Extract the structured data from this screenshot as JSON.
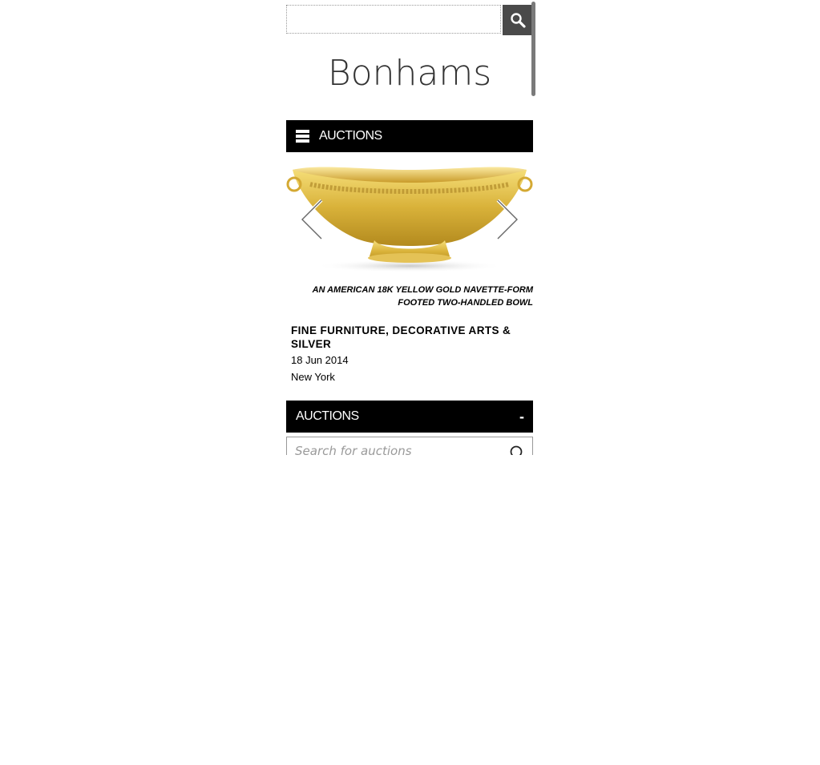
{
  "header": {
    "search_placeholder": "",
    "logo_text": "Bonhams"
  },
  "menu": {
    "label": "AUCTIONS"
  },
  "carousel": {
    "caption_line1": "AN AMERICAN 18K YELLOW GOLD NAVETTE-FORM",
    "caption_line2": "FOOTED TWO-HANDLED BOWL"
  },
  "auction": {
    "title": "FINE FURNITURE, DECORATIVE ARTS & SILVER",
    "date": "18 Jun 2014",
    "location": "New York"
  },
  "auctions_section": {
    "label": "AUCTIONS",
    "toggle": "-",
    "search_placeholder": "Search for auctions"
  },
  "colors": {
    "bar_background": "#000000",
    "gold": "#d9b23a"
  },
  "icons": [
    "search-icon",
    "hamburger-icon",
    "chevron-left-icon",
    "chevron-right-icon",
    "magnifier-icon"
  ]
}
